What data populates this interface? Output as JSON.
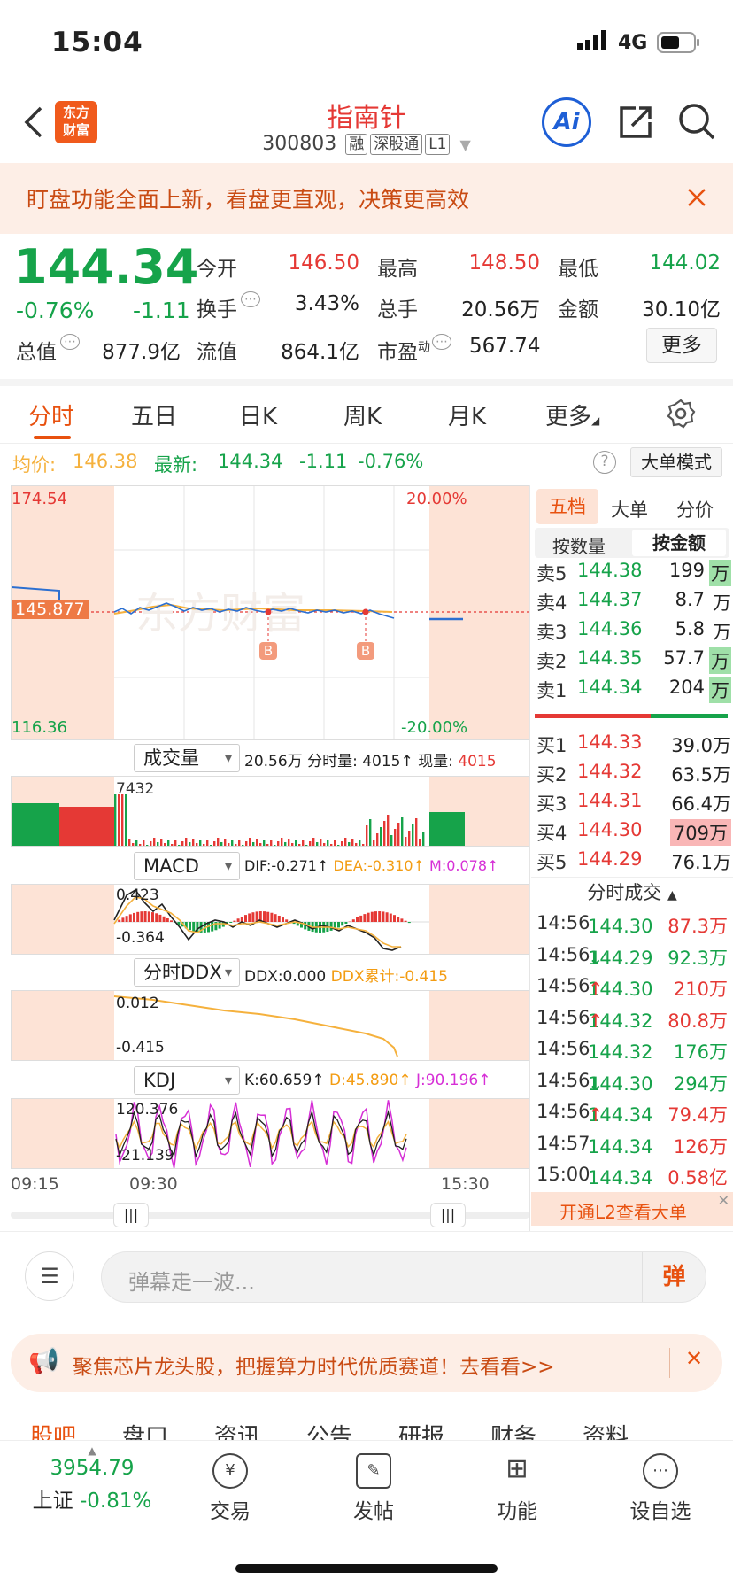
{
  "status": {
    "time": "15:04",
    "network": "4G"
  },
  "header": {
    "title": "指南针",
    "code": "300803",
    "tags": [
      "融",
      "深股通",
      "L1"
    ],
    "ai_label": "Ai"
  },
  "banner": {
    "text": "盯盘功能全面上新，看盘更直观，决策更高效"
  },
  "quote": {
    "price": "144.34",
    "change_pct": "-0.76%",
    "change": "-1.11",
    "open_label": "今开",
    "open": "146.50",
    "high_label": "最高",
    "high": "148.50",
    "low_label": "最低",
    "low": "144.02",
    "turnover_label": "换手",
    "turnover": "3.43%",
    "volume_label": "总手",
    "volume": "20.56万",
    "amount_label": "金额",
    "amount": "30.10亿",
    "mktcap_label": "总值",
    "mktcap": "877.9亿",
    "float_label": "流值",
    "float": "864.1亿",
    "pe_label": "市盈",
    "pe_sup": "动",
    "pe": "567.74",
    "more": "更多"
  },
  "tabs": {
    "items": [
      "分时",
      "五日",
      "日K",
      "周K",
      "月K",
      "更多"
    ],
    "active": 0
  },
  "info": {
    "avg_label": "均价:",
    "avg": "146.38",
    "last_label": "最新:",
    "last": "144.34",
    "chg": "-1.11",
    "pct": "-0.76%",
    "mode_btn": "大单模式"
  },
  "chart": {
    "price_top": "174.54",
    "price_bottom": "116.36",
    "pct_top": "20.00%",
    "pct_bottom": "-20.00%",
    "ref_price": "145.877",
    "markers": [
      "B",
      "B"
    ],
    "volume": {
      "selector": "成交量",
      "total": "20.56万",
      "fs_label": "分时量:",
      "fs_val": "4015",
      "now_label": "现量:",
      "now_val": "4015",
      "max": "7432"
    },
    "macd": {
      "selector": "MACD",
      "dif": "DIF:-0.271",
      "dea": "DEA:-0.310",
      "m": "M:0.078",
      "top": "0.423",
      "bottom": "-0.364"
    },
    "ddx": {
      "selector": "分时DDX",
      "ddx": "DDX:0.000",
      "ddx_acc": "DDX累计:-0.415",
      "top": "0.012",
      "bottom": "-0.415"
    },
    "kdj": {
      "selector": "KDJ",
      "k": "K:60.659",
      "d": "D:45.890",
      "j": "J:90.196",
      "top": "120.376",
      "bottom": "-21.139"
    },
    "time_start": "09:15",
    "time_mid": "09:30",
    "time_end": "15:30"
  },
  "orderbook": {
    "tabs": [
      "五档",
      "大单",
      "分价"
    ],
    "subtabs": [
      "按数量",
      "按金额"
    ],
    "asks": [
      {
        "label": "卖5",
        "price": "144.38",
        "vol": "199",
        "unit": "万"
      },
      {
        "label": "卖4",
        "price": "144.37",
        "vol": "8.7",
        "unit": "万"
      },
      {
        "label": "卖3",
        "price": "144.36",
        "vol": "5.8",
        "unit": "万"
      },
      {
        "label": "卖2",
        "price": "144.35",
        "vol": "57.7",
        "unit": "万"
      },
      {
        "label": "卖1",
        "price": "144.34",
        "vol": "204",
        "unit": "万"
      }
    ],
    "bids": [
      {
        "label": "买1",
        "price": "144.33",
        "vol": "39.0万"
      },
      {
        "label": "买2",
        "price": "144.32",
        "vol": "63.5万"
      },
      {
        "label": "买3",
        "price": "144.31",
        "vol": "66.4万"
      },
      {
        "label": "买4",
        "price": "144.30",
        "vol": "709万"
      },
      {
        "label": "买5",
        "price": "144.29",
        "vol": "76.1万"
      }
    ],
    "trades_title": "分时成交",
    "trades": [
      {
        "time": "14:56",
        "price": "144.30",
        "arrow": "",
        "vol": "87.3万",
        "color": "red"
      },
      {
        "time": "14:56",
        "price": "144.29",
        "arrow": "↓",
        "vol": "92.3万",
        "color": "green"
      },
      {
        "time": "14:56",
        "price": "144.30",
        "arrow": "↑",
        "vol": "210万",
        "color": "red"
      },
      {
        "time": "14:56",
        "price": "144.32",
        "arrow": "↑",
        "vol": "80.8万",
        "color": "red"
      },
      {
        "time": "14:56",
        "price": "144.32",
        "arrow": "",
        "vol": "176万",
        "color": "green"
      },
      {
        "time": "14:56",
        "price": "144.30",
        "arrow": "↓",
        "vol": "294万",
        "color": "green"
      },
      {
        "time": "14:56",
        "price": "144.34",
        "arrow": "↑",
        "vol": "79.4万",
        "color": "red"
      },
      {
        "time": "14:57",
        "price": "144.34",
        "arrow": "",
        "vol": "126万",
        "color": "red"
      },
      {
        "time": "15:00",
        "price": "144.34",
        "arrow": "",
        "vol": "0.58亿",
        "color": "red"
      }
    ],
    "l2": "开通L2查看大单"
  },
  "input": {
    "placeholder": "弹幕走一波...",
    "btn": "弹"
  },
  "ad": {
    "text": "聚焦芯片龙头股，把握算力时代优质赛道！去看看>>"
  },
  "bottom_tabs": [
    "股吧",
    "盘口",
    "资讯",
    "公告",
    "研报",
    "财务",
    "资料"
  ],
  "tabbar": {
    "index_value": "3954.79",
    "index_name": "上证",
    "index_pct": "-0.81%",
    "items": [
      "交易",
      "发帖",
      "功能",
      "设自选"
    ]
  },
  "colors": {
    "red": "#e53935",
    "green": "#16a34a",
    "accent": "#e8510f",
    "avg_line": "#f5b13d",
    "price_line": "#2b6fd1"
  }
}
